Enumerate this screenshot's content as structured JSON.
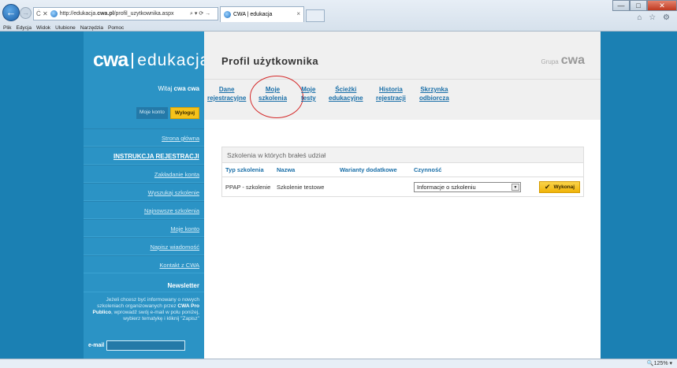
{
  "browser": {
    "address": {
      "prefix": "http://edukacja.",
      "domain": "cwa.pl",
      "path": "/profil_uzytkownika.aspx",
      "search_glyph": "⌕ ▾ ⟳ →"
    },
    "tab_title": "CWA | edukacja",
    "tab_close": "×",
    "menu": [
      "Plik",
      "Edycja",
      "Widok",
      "Ulubione",
      "Narzędzia",
      "Pomoc"
    ],
    "zoom": "🔍125% ▾",
    "nav_glyphs": {
      "back": "←",
      "forward": "→",
      "stop_refresh": "Ċ ✕"
    },
    "window_controls": {
      "minimize": "—",
      "maximize": "□",
      "close": "✕"
    },
    "toolbar_icons": "⌂ ☆ ⚙"
  },
  "sidebar": {
    "logo": {
      "cwa": "cwa",
      "edukacja": "edukacja"
    },
    "welcome": {
      "prefix": "Witaj ",
      "user": "cwa cwa"
    },
    "buttons": {
      "moje_konto": "Moje konto",
      "wyloguj": "Wyloguj"
    },
    "nav": [
      "Strona główna",
      "INSTRUKCJA REJESTRACJI",
      "Zakładanie konta",
      "Wyszukaj szkolenie",
      "Najnowsze szkolenia",
      "Moje konto",
      "Napisz wiadomość",
      "Kontakt z CWA"
    ],
    "newsletter": {
      "title": "Newsletter",
      "text_1": "Jeżeli chcesz być informowany o nowych szkoleniach organizowanych przez ",
      "text_bold": "CWA Pro Publico",
      "text_2": ", wprowadź swój e-mail w polu poniżej, wybierz tematykę i kliknij \"Zapisz\"",
      "email_label": "e-mail"
    }
  },
  "content": {
    "title": "Profil użytkownika",
    "grupa": {
      "label": "Grupa",
      "brand": "cwa"
    },
    "tabs": [
      {
        "line1": "Dane",
        "line2": "rejestracyjne"
      },
      {
        "line1": "Moje",
        "line2": "szkolenia"
      },
      {
        "line1": "Moje",
        "line2": "testy"
      },
      {
        "line1": "Ścieżki",
        "line2": "edukacyjne"
      },
      {
        "line1": "Historia",
        "line2": "rejestracji"
      },
      {
        "line1": "Skrzynka",
        "line2": "odbiorcza"
      }
    ],
    "table": {
      "caption": "Szkolenia w których brałeś udział",
      "headers": [
        "Typ szkolenia",
        "Nazwa",
        "Warianty dodatkowe",
        "Czynność"
      ],
      "rows": [
        {
          "typ": "PPAP - szkolenie",
          "nazwa": "Szkolenie testowe",
          "warianty": "",
          "czynnosc": "Informacje o szkoleniu"
        }
      ],
      "select_arrow": "▼",
      "action_button": "Wykonaj",
      "action_check": "✔"
    }
  }
}
